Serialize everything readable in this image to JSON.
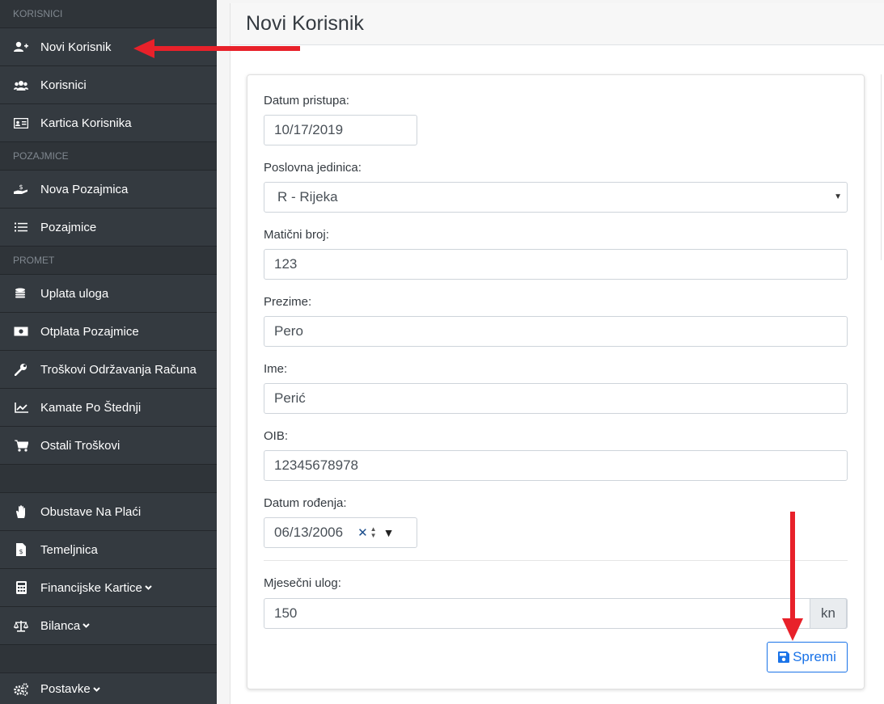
{
  "sidebar": {
    "sections": [
      {
        "label": "KORISNICI",
        "items": [
          {
            "label": "Novi Korisnik",
            "icon": "user-plus-icon"
          },
          {
            "label": "Korisnici",
            "icon": "users-icon"
          },
          {
            "label": "Kartica Korisnika",
            "icon": "id-card-icon"
          }
        ]
      },
      {
        "label": "POZAJMICE",
        "items": [
          {
            "label": "Nova Pozajmica",
            "icon": "hand-holding-usd-icon"
          },
          {
            "label": "Pozajmice",
            "icon": "list-icon"
          }
        ]
      },
      {
        "label": "PROMET",
        "items": [
          {
            "label": "Uplata uloga",
            "icon": "coins-icon"
          },
          {
            "label": "Otplata Pozajmice",
            "icon": "money-bill-icon"
          },
          {
            "label": "Troškovi Održavanja Računa",
            "icon": "wrench-icon"
          },
          {
            "label": "Kamate Po Štednji",
            "icon": "chart-line-icon"
          },
          {
            "label": "Ostali Troškovi",
            "icon": "shopping-cart-icon"
          }
        ]
      }
    ],
    "extra_items": [
      {
        "label": "Obustave Na Plaći",
        "icon": "hand-icon"
      },
      {
        "label": "Temeljnica",
        "icon": "file-invoice-icon"
      },
      {
        "label": "Financijske Kartice",
        "icon": "calculator-icon"
      },
      {
        "label": "Bilanca",
        "icon": "balance-scale-icon"
      }
    ],
    "settings": {
      "label": "Postavke",
      "icon": "cogs-icon"
    }
  },
  "page": {
    "title": "Novi Korisnik"
  },
  "form": {
    "datum_pristupa": {
      "label": "Datum pristupa:",
      "value": "10/17/2019"
    },
    "poslovna_jedinica": {
      "label": "Poslovna jedinica:",
      "value": "R - Rijeka"
    },
    "maticni_broj": {
      "label": "Matični broj:",
      "value": "123"
    },
    "prezime": {
      "label": "Prezime:",
      "value": "Pero"
    },
    "ime": {
      "label": "Ime:",
      "value": "Perić"
    },
    "oib": {
      "label": "OIB:",
      "value": "12345678978"
    },
    "datum_rodenja": {
      "label": "Datum rođenja:",
      "value": "06/13/2006"
    },
    "mjesecni_ulog": {
      "label": "Mjesečni ulog:",
      "value": "150",
      "addon": "kn"
    },
    "save_label": "Spremi"
  },
  "colors": {
    "sidebar": "#343a40",
    "accent": "#1a73e8",
    "arrow": "#e8212a"
  }
}
